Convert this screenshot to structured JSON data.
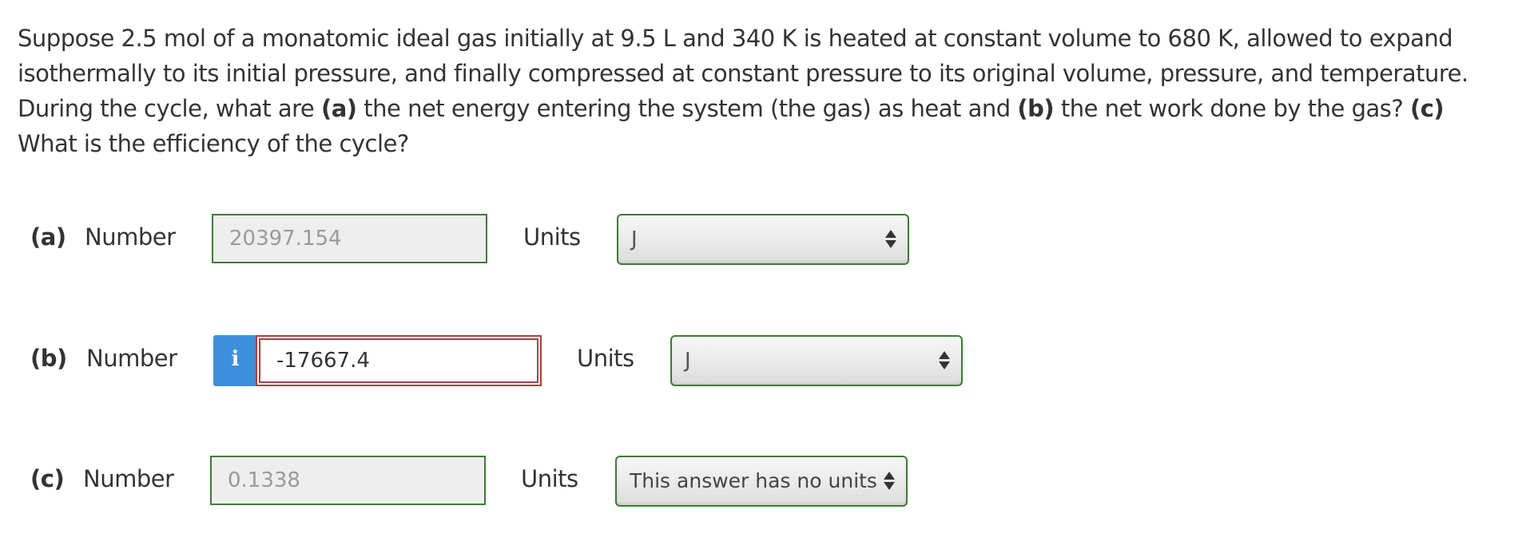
{
  "question": {
    "text_1": "Suppose 2.5 mol of a monatomic ideal gas initially at 9.5 L and 340 K is heated at constant volume to 680 K, allowed to expand isothermally to its initial pressure, and finally compressed at constant pressure to its original volume, pressure, and temperature. During the cycle, what are ",
    "part_a_marker": "(a)",
    "text_2": " the net energy entering the system (the gas) as heat and ",
    "part_b_marker": "(b)",
    "text_3": " the net work done by the gas? ",
    "part_c_marker": "(c)",
    "text_4": " What is the efficiency of the cycle?"
  },
  "parts": [
    {
      "label": "(a)",
      "number_label": "Number",
      "value": "20397.154",
      "state": "correct",
      "units_label": "Units",
      "units_value": "J"
    },
    {
      "label": "(b)",
      "number_label": "Number",
      "info_icon": "i",
      "value": "-17667.4",
      "state": "incorrect",
      "units_label": "Units",
      "units_value": "J"
    },
    {
      "label": "(c)",
      "number_label": "Number",
      "value": "0.1338",
      "state": "correct",
      "units_label": "Units",
      "units_value": "This answer has no units"
    }
  ],
  "colors": {
    "correct_border": "#3c7d34",
    "incorrect_border": "#a8423f",
    "info_button": "#3d8fdb"
  },
  "icons": {
    "info": "info-icon",
    "select_arrows": "select-arrows-icon"
  }
}
